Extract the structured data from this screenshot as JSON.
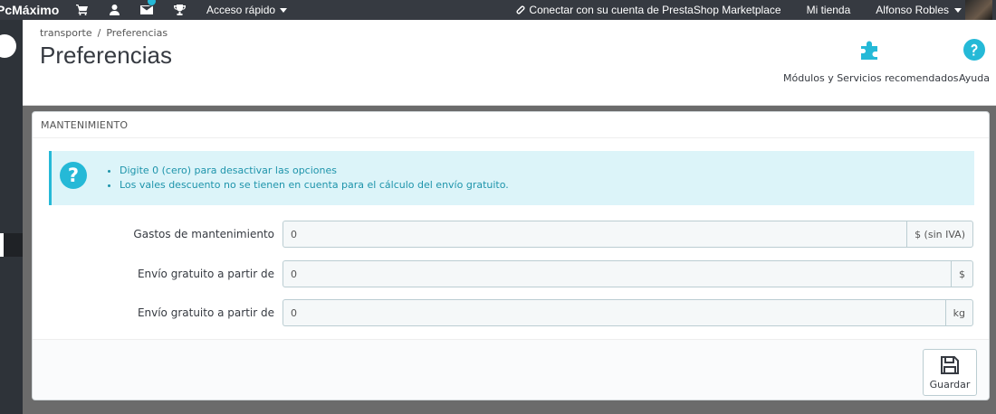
{
  "topbar": {
    "brand": "PcMáximo",
    "quick_access": "Acceso rápido",
    "marketplace_link": "Conectar con su cuenta de PrestaShop Marketplace",
    "my_store": "Mi tienda",
    "user_name": "Alfonso Robles",
    "icons": [
      "cart-icon",
      "user-icon",
      "envelope-icon",
      "trophy-icon"
    ]
  },
  "breadcrumb": {
    "parent": "transporte",
    "separator": "/",
    "current": "Preferencias"
  },
  "page_title": "Preferencias",
  "header_actions": {
    "modules_label": "Módulos y Servicios recomendados",
    "help_label": "Ayuda"
  },
  "panel": {
    "heading": "MANTENIMIENTO",
    "info": [
      "Digite 0 (cero) para desactivar las opciones",
      "Los vales descuento no se tienen en cuenta para el cálculo del envío gratuito."
    ],
    "fields": [
      {
        "label": "Gastos de mantenimiento",
        "value": "0",
        "suffix": "$ (sin IVA)"
      },
      {
        "label": "Envío gratuito a partir de",
        "value": "0",
        "suffix": "$"
      },
      {
        "label": "Envío gratuito a partir de",
        "value": "0",
        "suffix": "kg"
      }
    ],
    "save_label": "Guardar"
  },
  "colors": {
    "accent": "#25b9d7",
    "topbar": "#363a41",
    "alert_bg": "#dcf4f9"
  }
}
